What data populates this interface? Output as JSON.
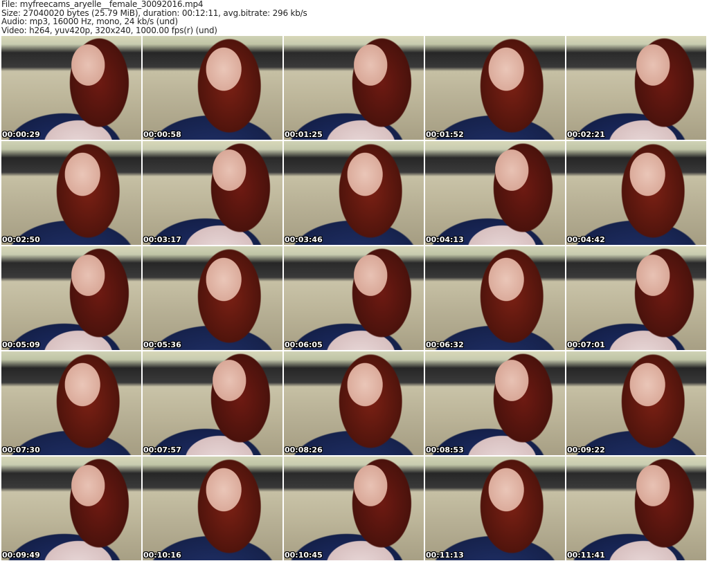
{
  "header": {
    "file": "File: myfreecams_aryelle__female_30092016.mp4",
    "size": "Size: 27040020 bytes (25.79 MiB), duration: 00:12:11, avg.bitrate: 296 kb/s",
    "audio": "Audio: mp3, 16000 Hz, mono, 24 kb/s (und)",
    "video": "Video: h264, yuv420p, 320x240, 1000.00 fps(r) (und)"
  },
  "thumbnails": [
    {
      "time": "00:00:29"
    },
    {
      "time": "00:00:58"
    },
    {
      "time": "00:01:25"
    },
    {
      "time": "00:01:52"
    },
    {
      "time": "00:02:21"
    },
    {
      "time": "00:02:50"
    },
    {
      "time": "00:03:17"
    },
    {
      "time": "00:03:46"
    },
    {
      "time": "00:04:13"
    },
    {
      "time": "00:04:42"
    },
    {
      "time": "00:05:09"
    },
    {
      "time": "00:05:36"
    },
    {
      "time": "00:06:05"
    },
    {
      "time": "00:06:32"
    },
    {
      "time": "00:07:01"
    },
    {
      "time": "00:07:30"
    },
    {
      "time": "00:07:57"
    },
    {
      "time": "00:08:26"
    },
    {
      "time": "00:08:53"
    },
    {
      "time": "00:09:22"
    },
    {
      "time": "00:09:49"
    },
    {
      "time": "00:10:16"
    },
    {
      "time": "00:10:45"
    },
    {
      "time": "00:11:13"
    },
    {
      "time": "00:11:41"
    }
  ]
}
